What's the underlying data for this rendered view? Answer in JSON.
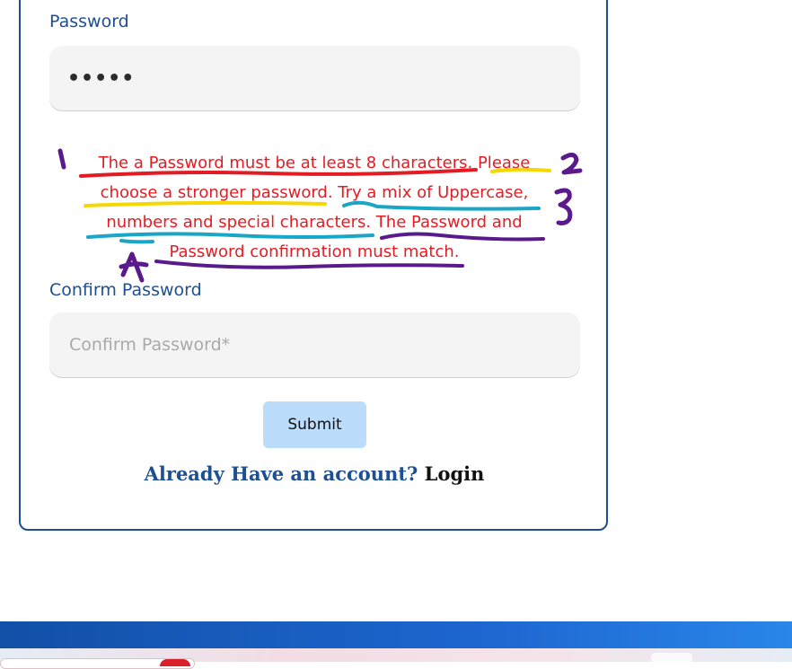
{
  "form": {
    "password_label": "Password",
    "password_value": "•••••",
    "error_text": "The a Password must be at least 8 characters. Please choose a stronger password. Try a mix of Uppercase, numbers and special characters. The Password and Password confirmation must match.",
    "confirm_label": "Confirm Password",
    "confirm_placeholder": "Confirm Password*",
    "confirm_value": "",
    "submit_label": "Submit",
    "account_question": "Already Have an account?",
    "login_label": "Login"
  },
  "annotations": {
    "marker_1": "1",
    "marker_2": "2",
    "marker_3": "3",
    "marker_4": "4"
  },
  "colors": {
    "brand": "#1d4f91",
    "error": "#e51c23",
    "submit_bg": "#bcdcfb",
    "annot_red": "#e31b23",
    "annot_yellow": "#f5d800",
    "annot_cyan": "#1aa6c7",
    "annot_purple": "#5b1a8c"
  }
}
